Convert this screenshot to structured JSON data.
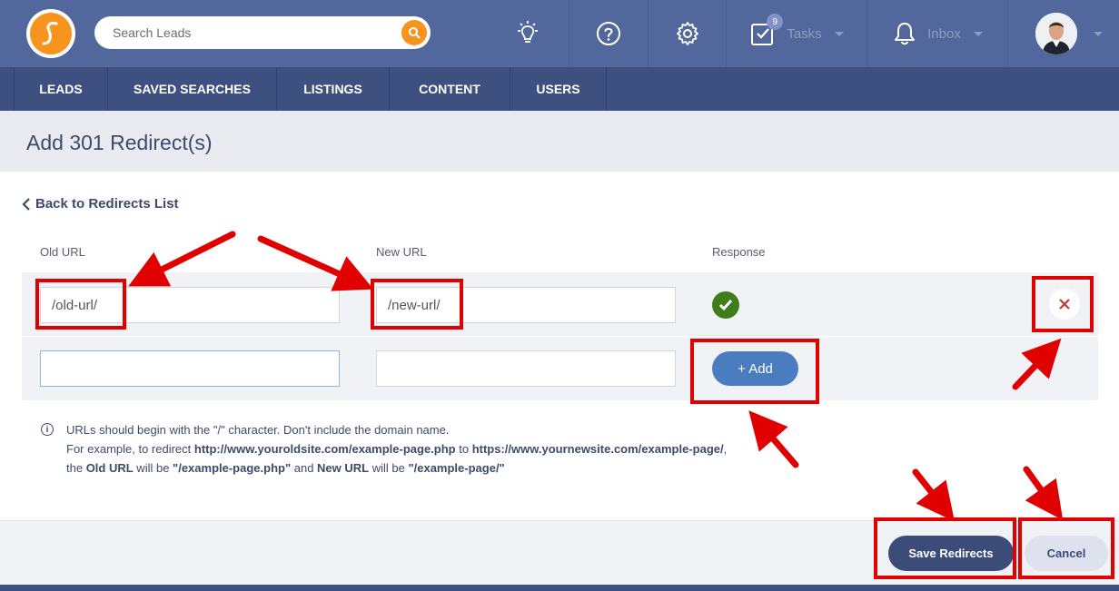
{
  "header": {
    "search_placeholder": "Search Leads",
    "tasks_label": "Tasks",
    "tasks_badge": "9",
    "inbox_label": "Inbox"
  },
  "nav": {
    "items": [
      {
        "label": "LEADS"
      },
      {
        "label": "SAVED SEARCHES"
      },
      {
        "label": "LISTINGS"
      },
      {
        "label": "CONTENT"
      },
      {
        "label": "USERS"
      }
    ]
  },
  "page": {
    "title": "Add 301 Redirect(s)",
    "back_link": "Back to Redirects List"
  },
  "table": {
    "col_old": "Old URL",
    "col_new": "New URL",
    "col_response": "Response",
    "rows": [
      {
        "old": "/old-url/",
        "new": "/new-url/"
      },
      {
        "old": "",
        "new": ""
      }
    ],
    "add_label": "+ Add"
  },
  "info": {
    "line1": "URLs should begin with the \"/\" character. Don't include the domain name.",
    "line2_a": "For example, to redirect ",
    "line2_b": "http://www.youroldsite.com/example-page.php",
    "line2_c": " to ",
    "line2_d": "https://www.yournewsite.com/example-page/",
    "line2_e": ",",
    "line3_a": "the ",
    "line3_b": "Old URL",
    "line3_c": " will be ",
    "line3_d": "\"/example-page.php\"",
    "line3_e": " and ",
    "line3_f": "New URL",
    "line3_g": " will be ",
    "line3_h": "\"/example-page/\""
  },
  "footer": {
    "save_label": "Save Redirects",
    "cancel_label": "Cancel"
  },
  "colors": {
    "header_bg": "#52689c",
    "nav_bg": "#3d5080",
    "accent": "#f7941d",
    "success": "#3e7d1a",
    "annotation": "#e00000"
  }
}
